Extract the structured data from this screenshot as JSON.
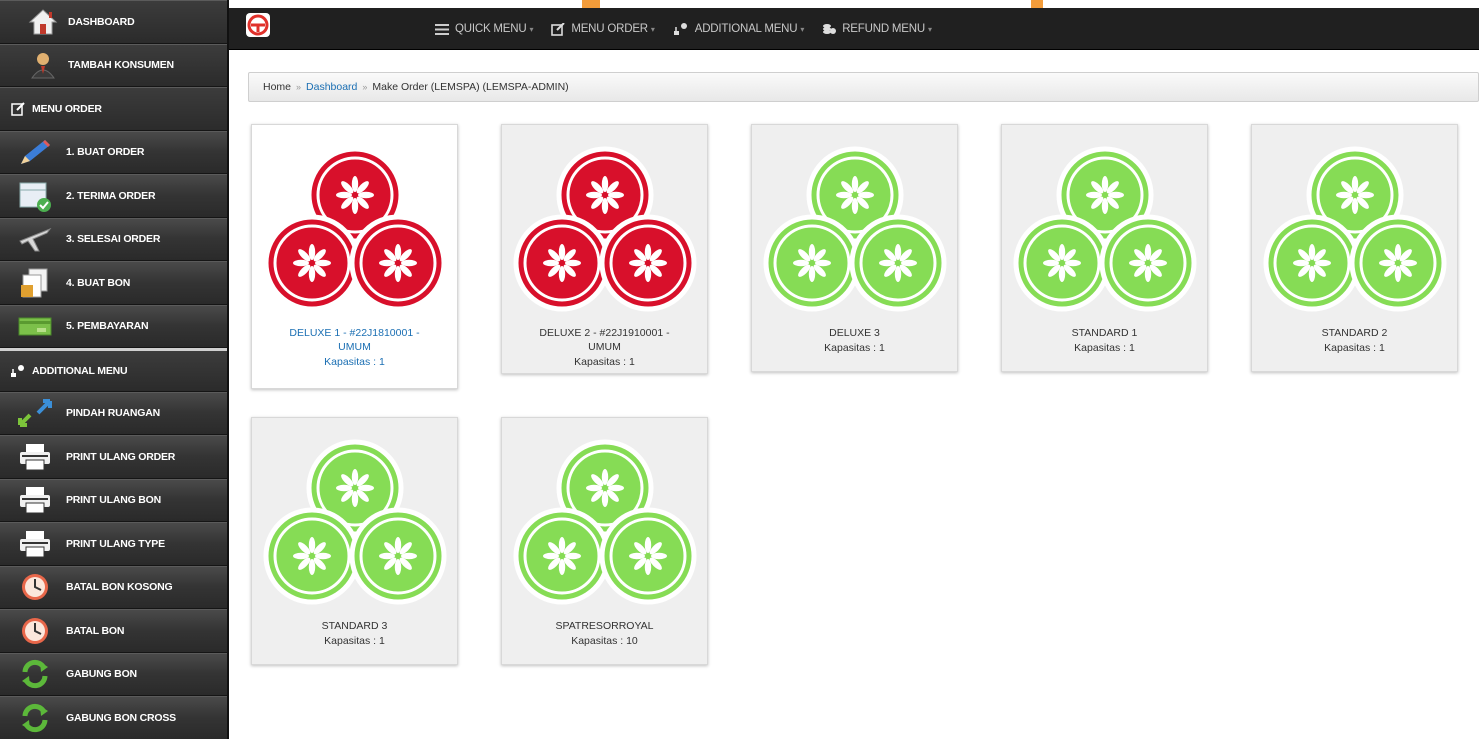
{
  "colors": {
    "occupied": "#d8102b",
    "available": "#86dc55",
    "link": "#1b6fb3"
  },
  "sidebar": {
    "items": [
      {
        "label": "DASHBOARD",
        "icon": "home-icon"
      },
      {
        "label": "TAMBAH KONSUMEN",
        "icon": "user-icon"
      },
      {
        "label": "MENU ORDER",
        "icon": "edit-icon"
      },
      {
        "label": "1. BUAT ORDER",
        "icon": "pencil-icon"
      },
      {
        "label": "2. TERIMA ORDER",
        "icon": "calendar-check-icon"
      },
      {
        "label": "3. SELESAI ORDER",
        "icon": "plane-icon"
      },
      {
        "label": "4. BUAT BON",
        "icon": "documents-icon"
      },
      {
        "label": "5. PEMBAYARAN",
        "icon": "cash-icon"
      },
      {
        "label": "ADDITIONAL MENU",
        "icon": "user-plus-icon"
      },
      {
        "label": "PINDAH RUANGAN",
        "icon": "arrows-icon"
      },
      {
        "label": "PRINT ULANG ORDER",
        "icon": "printer-icon"
      },
      {
        "label": "PRINT ULANG BON",
        "icon": "printer-icon"
      },
      {
        "label": "PRINT ULANG TYPE",
        "icon": "printer-icon"
      },
      {
        "label": "BATAL BON KOSONG",
        "icon": "clock-icon"
      },
      {
        "label": "BATAL BON",
        "icon": "clock-icon"
      },
      {
        "label": "GABUNG BON",
        "icon": "refresh-icon"
      },
      {
        "label": "GABUNG BON CROSS",
        "icon": "refresh-icon"
      }
    ]
  },
  "topbar": {
    "logo_icon": "brand-logo-icon",
    "menus": [
      {
        "label": "QUICK MENU",
        "icon": "list-icon"
      },
      {
        "label": "MENU ORDER",
        "icon": "edit-icon"
      },
      {
        "label": "ADDITIONAL MENU",
        "icon": "user-plus-icon"
      },
      {
        "label": "REFUND MENU",
        "icon": "coins-icon"
      }
    ]
  },
  "breadcrumb": {
    "home": "Home",
    "dashboard": "Dashboard",
    "current": "Make Order (LEMSPA) (LEMSPA-ADMIN)"
  },
  "rooms": [
    {
      "name": "DELUXE 1 - #22J1810001 - UMUM",
      "capacity": "Kapasitas : 1",
      "status": "occupied",
      "selected": true
    },
    {
      "name": "DELUXE 2 - #22J1910001 - UMUM",
      "capacity": "Kapasitas : 1",
      "status": "occupied",
      "selected": false
    },
    {
      "name": "DELUXE 3",
      "capacity": "Kapasitas : 1",
      "status": "available",
      "selected": false
    },
    {
      "name": "STANDARD 1",
      "capacity": "Kapasitas : 1",
      "status": "available",
      "selected": false
    },
    {
      "name": "STANDARD 2",
      "capacity": "Kapasitas : 1",
      "status": "available",
      "selected": false
    },
    {
      "name": "STANDARD 3",
      "capacity": "Kapasitas : 1",
      "status": "available",
      "selected": false
    },
    {
      "name": "SPATRESORROYAL",
      "capacity": "Kapasitas : 10",
      "status": "available",
      "selected": false
    }
  ]
}
